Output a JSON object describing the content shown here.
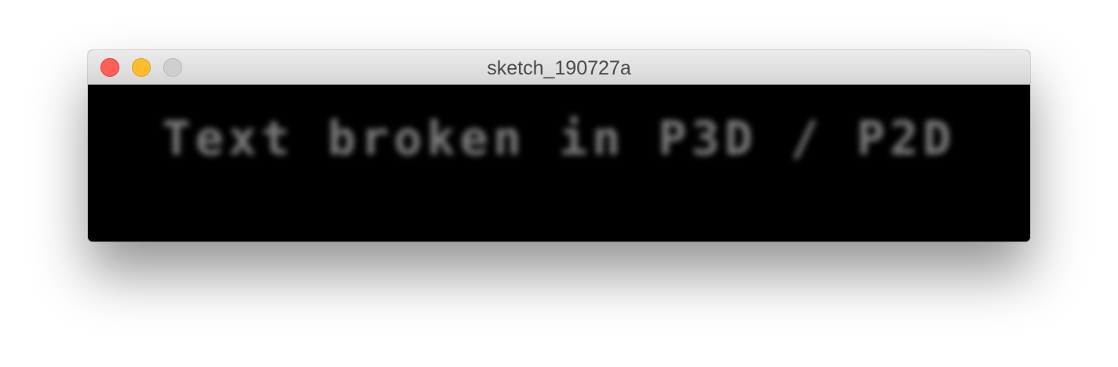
{
  "window": {
    "title": "sketch_190727a"
  },
  "canvas": {
    "text": "Text broken in P3D / P2D",
    "background": "#000000",
    "text_color": "#7a7a7a"
  },
  "colors": {
    "close": "#fe5f57",
    "minimize": "#febc2e",
    "zoom": "#cfcfcf"
  }
}
